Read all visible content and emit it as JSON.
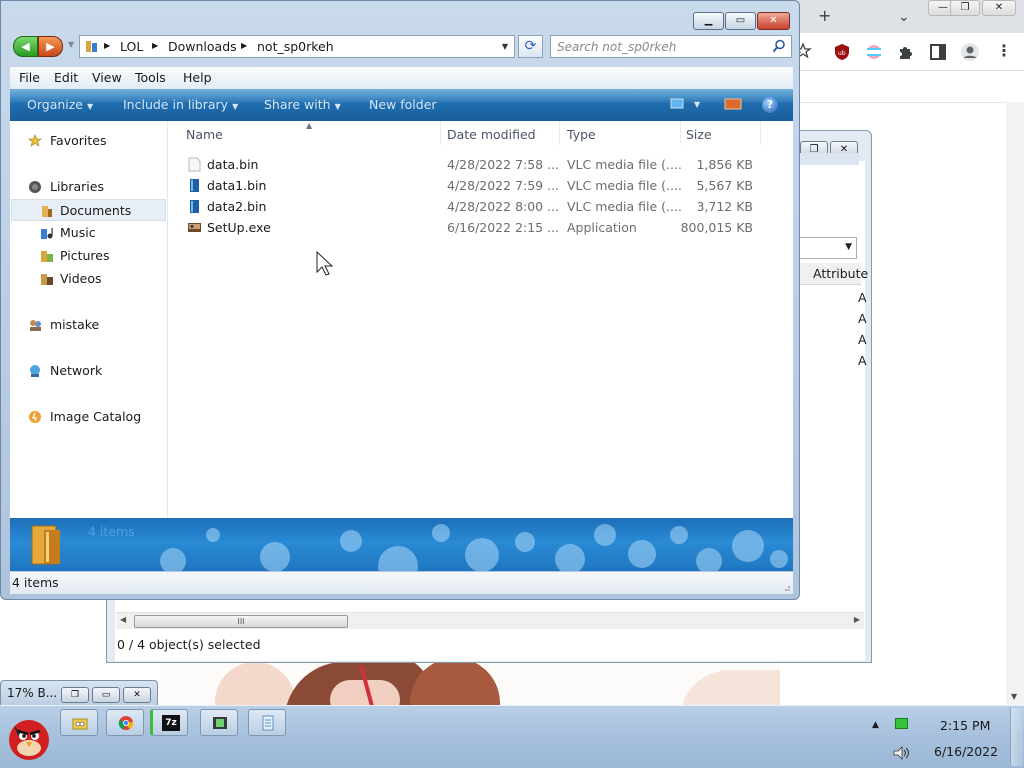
{
  "explorer": {
    "breadcrumb": [
      "LOL",
      "Downloads",
      "not_sp0rkeh"
    ],
    "search_placeholder": "Search not_sp0rkeh",
    "menu": [
      "File",
      "Edit",
      "View",
      "Tools",
      "Help"
    ],
    "commands": {
      "organize": "Organize",
      "include": "Include in library",
      "share": "Share with",
      "new_folder": "New folder"
    },
    "nav": {
      "favorites": "Favorites",
      "libraries": "Libraries",
      "documents": "Documents",
      "music": "Music",
      "pictures": "Pictures",
      "videos": "Videos",
      "mistake": "mistake",
      "network": "Network",
      "image_catalog": "Image Catalog"
    },
    "columns": {
      "name": "Name",
      "date": "Date modified",
      "type": "Type",
      "size": "Size"
    },
    "files": [
      {
        "name": "data.bin",
        "date": "4/28/2022 7:58 ...",
        "type": "VLC media file (....",
        "size": "1,856 KB"
      },
      {
        "name": "data1.bin",
        "date": "4/28/2022 7:59 ...",
        "type": "VLC media file (....",
        "size": "5,567 KB"
      },
      {
        "name": "data2.bin",
        "date": "4/28/2022 8:00 ...",
        "type": "VLC media file (....",
        "size": "3,712 KB"
      },
      {
        "name": "SetUp.exe",
        "date": "6/16/2022 2:15 ...",
        "type": "Application",
        "size": "800,015 KB"
      }
    ],
    "details_count": "4 items",
    "status": "4 items"
  },
  "zip": {
    "column_attr": "Attribute",
    "attr_letters": [
      "A",
      "A",
      "A",
      "A"
    ],
    "status": "0 / 4 object(s) selected",
    "scroll_grip": "III"
  },
  "chrome": {
    "new_tab": "+",
    "tab_dropdown": "⌄"
  },
  "miniwin": {
    "title": "17% B..."
  },
  "taskbar": {
    "time": "2:15 PM",
    "date": "6/16/2022"
  },
  "colors": {
    "command_bar": "#1f6fb2",
    "taskbar": "#a6c0dc",
    "details_pane": "#2a8ad4"
  },
  "icons": {
    "zip_app": "7z"
  }
}
